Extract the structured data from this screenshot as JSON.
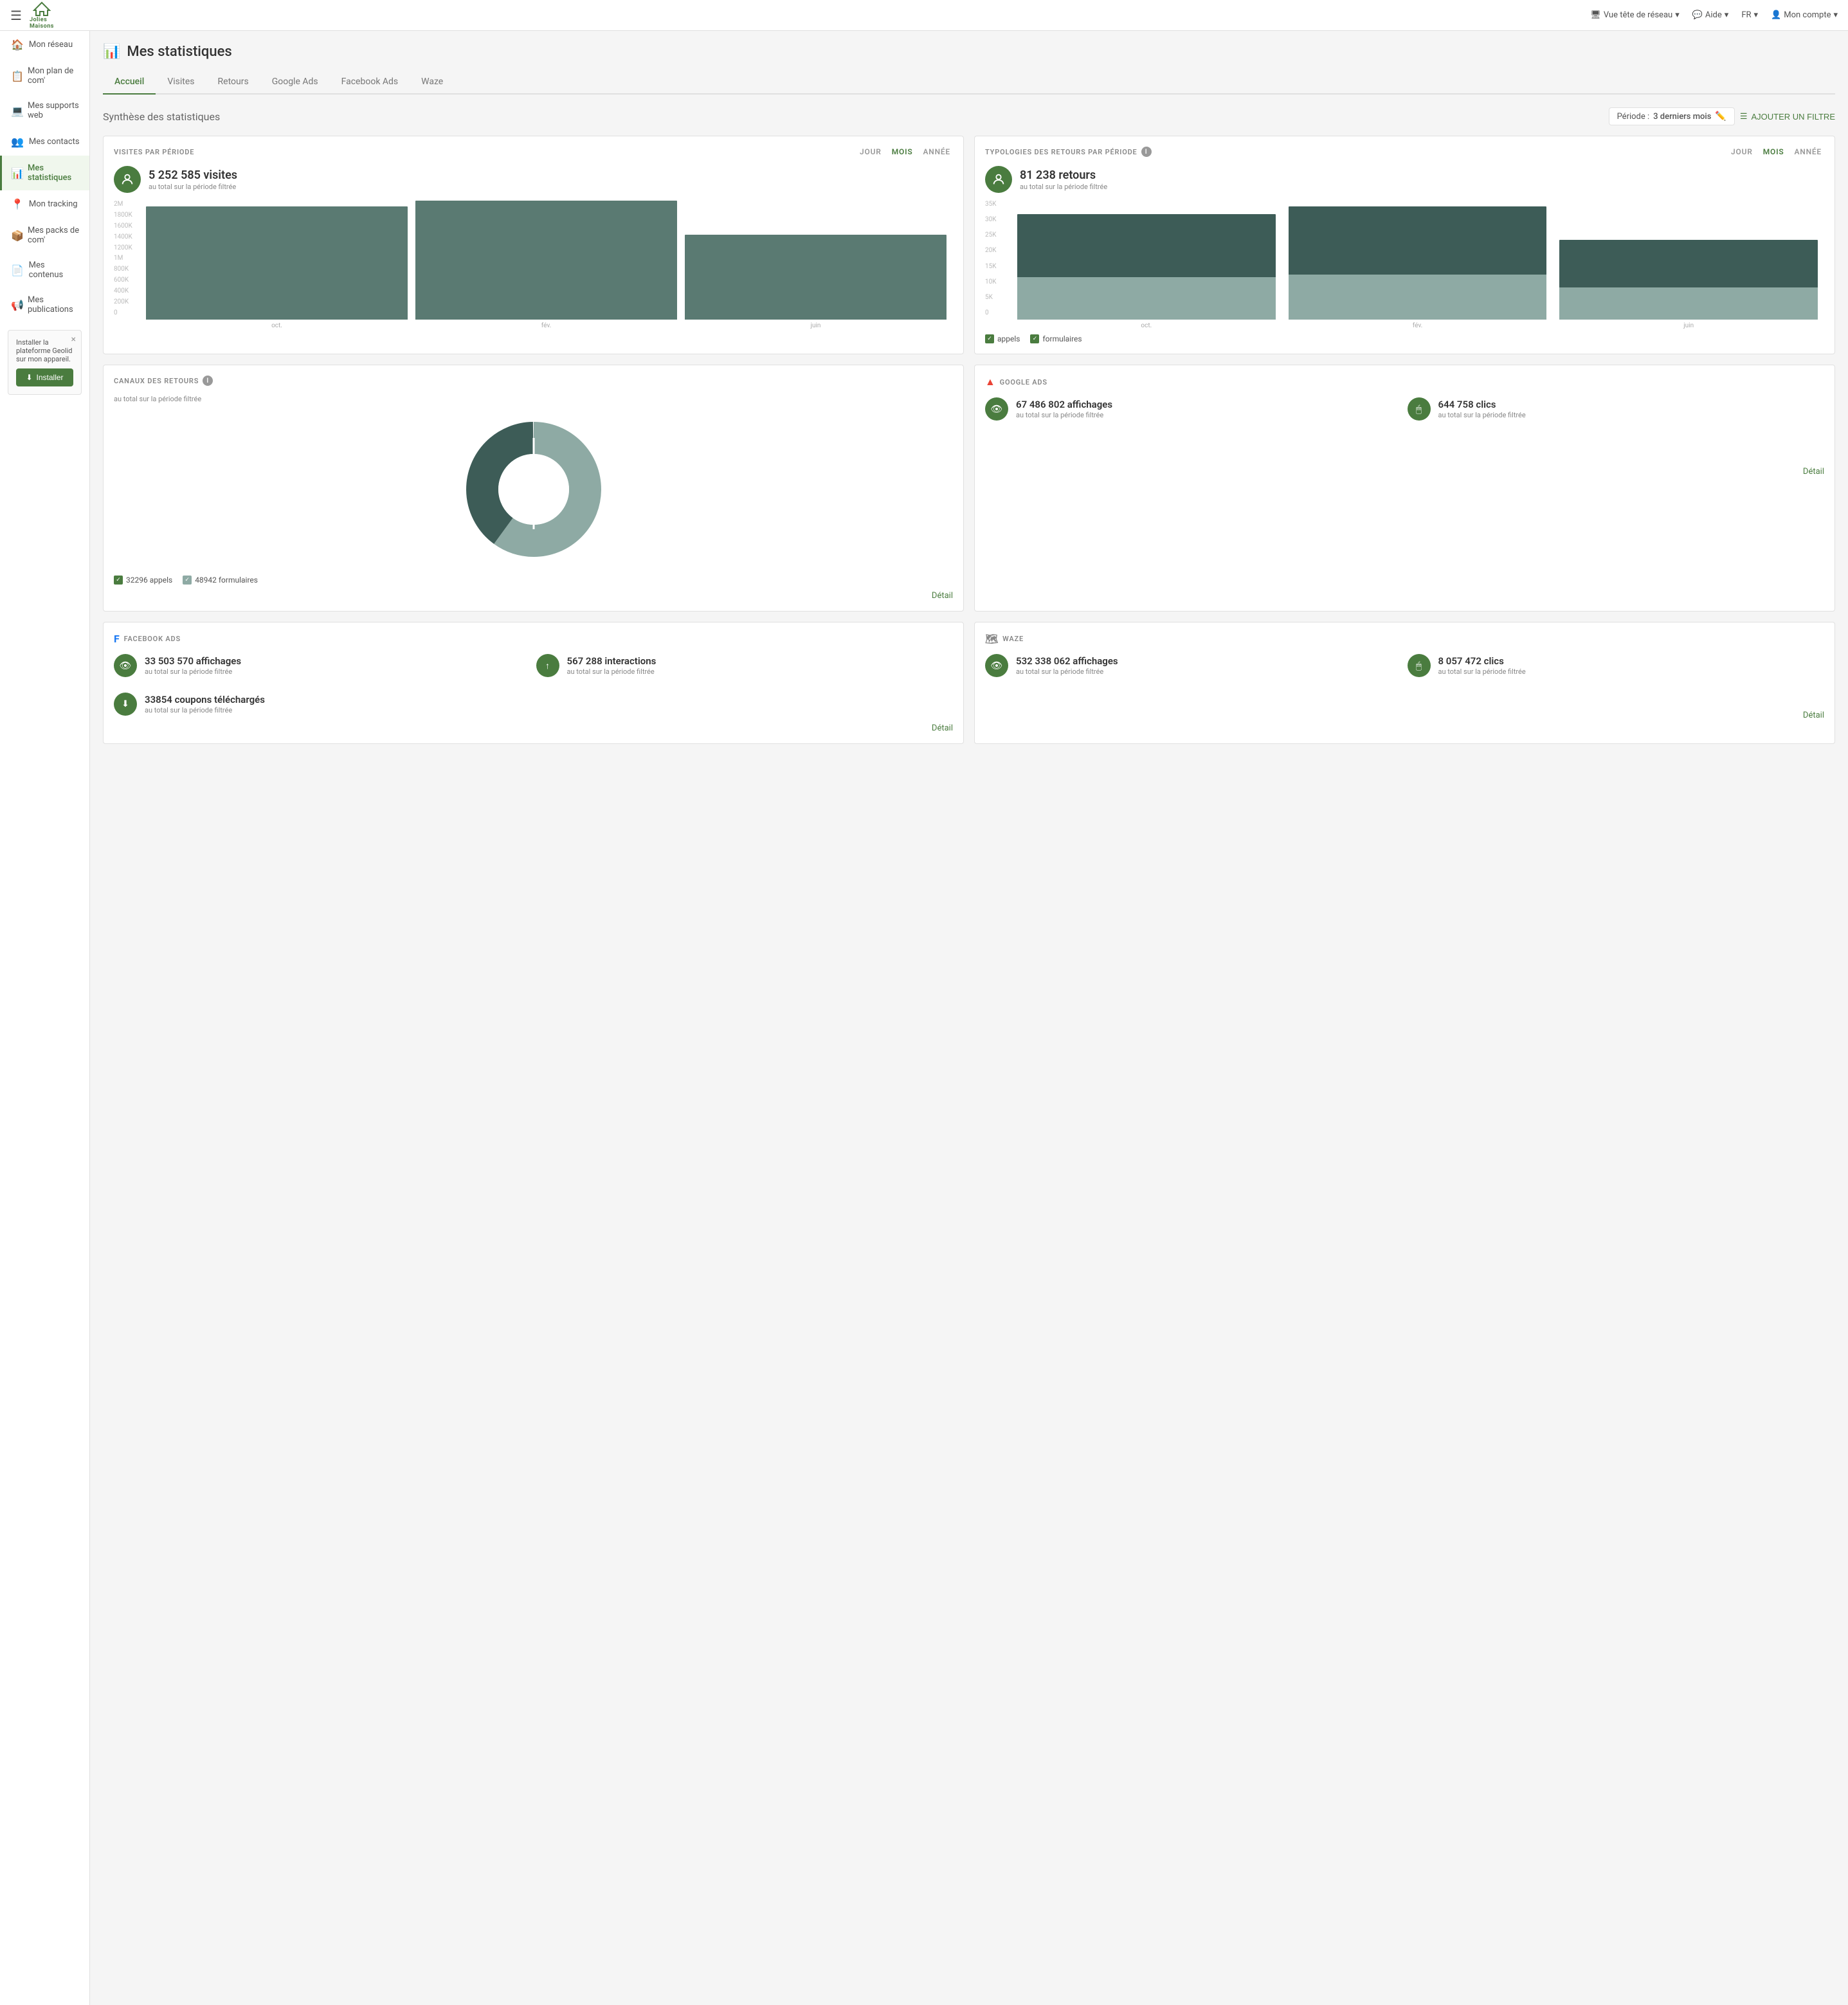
{
  "topNav": {
    "logoText": "Jolies\nMaisons",
    "viewLabel": "Vue tête de réseau",
    "helpLabel": "Aide",
    "langLabel": "FR",
    "accountLabel": "Mon compte"
  },
  "sidebar": {
    "items": [
      {
        "id": "mon-reseau",
        "label": "Mon réseau",
        "icon": "🏠"
      },
      {
        "id": "mon-plan-com",
        "label": "Mon plan de com'",
        "icon": "📋"
      },
      {
        "id": "mes-supports-web",
        "label": "Mes supports web",
        "icon": "💻"
      },
      {
        "id": "mes-contacts",
        "label": "Mes contacts",
        "icon": "👥"
      },
      {
        "id": "mes-statistiques",
        "label": "Mes statistiques",
        "icon": "📊",
        "active": true
      },
      {
        "id": "mon-tracking",
        "label": "Mon tracking",
        "icon": "📍"
      },
      {
        "id": "mes-packs-com",
        "label": "Mes packs de com'",
        "icon": "📦"
      },
      {
        "id": "mes-contenus",
        "label": "Mes contenus",
        "icon": "📄"
      },
      {
        "id": "mes-publications",
        "label": "Mes publications",
        "icon": "📢"
      }
    ],
    "install": {
      "text": "Installer la plateforme Geolid sur mon appareil.",
      "buttonLabel": "Installer"
    }
  },
  "page": {
    "title": "Mes statistiques",
    "tabs": [
      {
        "id": "accueil",
        "label": "Accueil",
        "active": true
      },
      {
        "id": "visites",
        "label": "Visites"
      },
      {
        "id": "retours",
        "label": "Retours"
      },
      {
        "id": "google-ads",
        "label": "Google Ads"
      },
      {
        "id": "facebook-ads",
        "label": "Facebook Ads"
      },
      {
        "id": "waze",
        "label": "Waze"
      }
    ],
    "sectionTitle": "Synthèse des statistiques",
    "period": {
      "label": "Période :",
      "value": "3 derniers mois"
    },
    "addFilterLabel": "AJOUTER UN FILTRE"
  },
  "cards": {
    "visitesParPeriode": {
      "title": "VISITES PAR PÉRIODE",
      "periodBtns": [
        "Jour",
        "Mois",
        "Année"
      ],
      "activePeriod": "Mois",
      "totalValue": "5 252 585 visites",
      "totalLabel": "au total sur la période filtrée",
      "bars": [
        {
          "label": "oct.",
          "heightPct": 88
        },
        {
          "label": "fév.",
          "heightPct": 95
        },
        {
          "label": "juin",
          "heightPct": 66
        }
      ],
      "yLabels": [
        "2M",
        "1800K",
        "1600K",
        "1400K",
        "1200K",
        "1M",
        "800K",
        "600K",
        "400K",
        "200K",
        "0"
      ]
    },
    "typologiesRetours": {
      "title": "TYPOLOGIES DES RETOURS PAR PÉRIODE",
      "periodBtns": [
        "Jour",
        "Mois",
        "Année"
      ],
      "activePeriod": "Mois",
      "totalValue": "81 238 retours",
      "totalLabel": "au total sur la période filtrée",
      "bars": [
        {
          "label": "oct.",
          "darkPct": 42,
          "lightPct": 32
        },
        {
          "label": "fév.",
          "darkPct": 40,
          "lightPct": 36
        },
        {
          "label": "juin",
          "darkPct": 30,
          "lightPct": 24
        }
      ],
      "yLabels": [
        "35K",
        "30K",
        "25K",
        "20K",
        "15K",
        "10K",
        "5K",
        "0"
      ],
      "legend": [
        {
          "key": "appels",
          "label": "appels"
        },
        {
          "key": "formulaires",
          "label": "formulaires"
        }
      ]
    },
    "canauxRetours": {
      "title": "CANAUX DES RETOURS",
      "subtitle": "au total sur la période filtrée",
      "legend": [
        {
          "label": "32296 appels",
          "value": "32296",
          "type": "dark"
        },
        {
          "label": "48942 formulaires",
          "value": "48942",
          "type": "light"
        }
      ],
      "detailLabel": "Détail",
      "donut": {
        "darkPct": 40,
        "lightPct": 60
      }
    },
    "googleAds": {
      "title": "GOOGLE ADS",
      "stats": [
        {
          "icon": "👁",
          "value": "67 486 802 affichages",
          "label": "au total sur la période filtrée"
        },
        {
          "icon": "🖱",
          "value": "644 758 clics",
          "label": "au total sur la période filtrée"
        }
      ],
      "detailLabel": "Détail"
    },
    "facebookAds": {
      "title": "FACEBOOK ADS",
      "stats": [
        {
          "icon": "👁",
          "value": "33 503 570 affichages",
          "label": "au total sur la période filtrée"
        },
        {
          "icon": "↑",
          "value": "567 288 interactions",
          "label": "au total sur la période filtrée"
        },
        {
          "icon": "⬇",
          "value": "33854 coupons téléchargés",
          "label": "au total sur la période filtrée"
        }
      ],
      "detailLabel": "Détail"
    },
    "waze": {
      "title": "WAZE",
      "stats": [
        {
          "icon": "👁",
          "value": "532 338 062 affichages",
          "label": "au total sur la période filtrée"
        },
        {
          "icon": "🖱",
          "value": "8 057 472 clics",
          "label": "au total sur la période filtrée"
        }
      ],
      "detailLabel": "Détail"
    }
  }
}
